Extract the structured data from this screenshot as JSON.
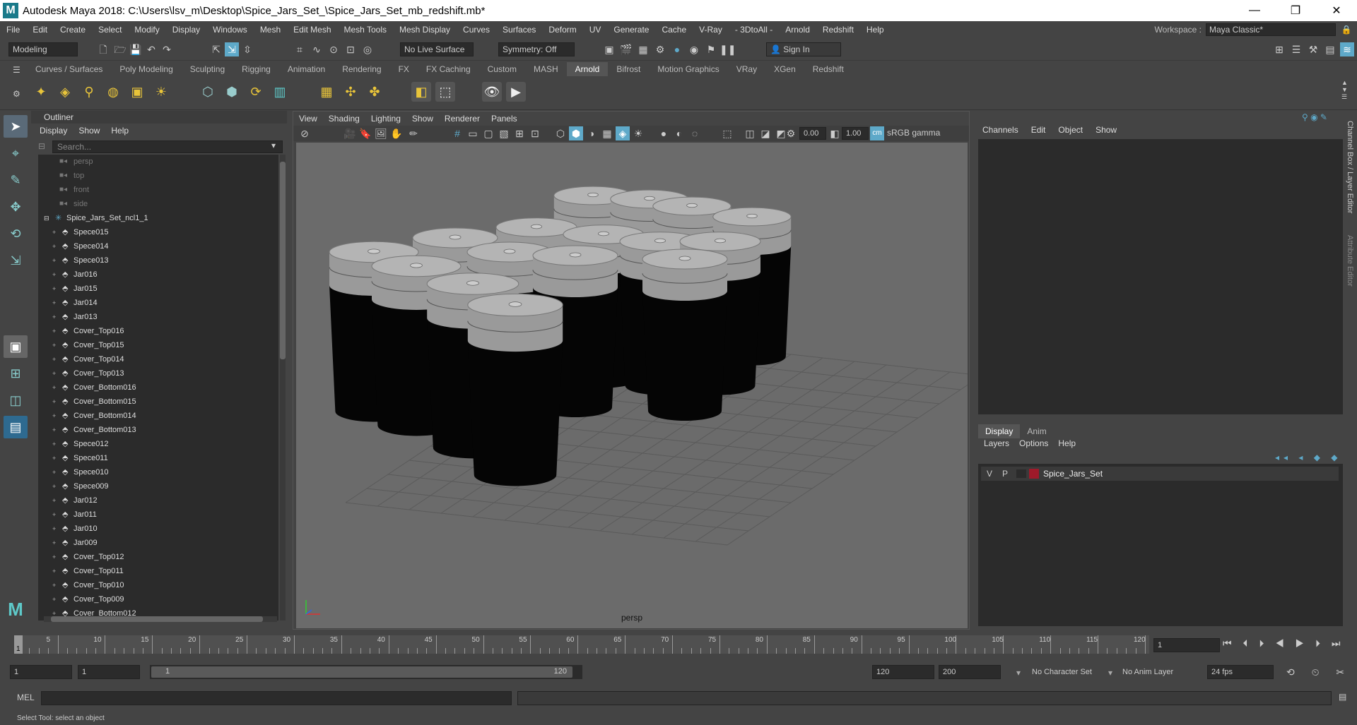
{
  "window": {
    "title": "Autodesk Maya 2018: C:\\Users\\lsv_m\\Desktop\\Spice_Jars_Set_\\Spice_Jars_Set_mb_redshift.mb*",
    "logo": "M"
  },
  "menu": [
    "File",
    "Edit",
    "Create",
    "Select",
    "Modify",
    "Display",
    "Windows",
    "Mesh",
    "Edit Mesh",
    "Mesh Tools",
    "Mesh Display",
    "Curves",
    "Surfaces",
    "Deform",
    "UV",
    "Generate",
    "Cache",
    "V-Ray",
    "- 3DtoAll -",
    "Arnold",
    "Redshift",
    "Help"
  ],
  "workspace": {
    "label": "Workspace :",
    "value": "Maya Classic*"
  },
  "status": {
    "mode": "Modeling",
    "live_surface": "No Live Surface",
    "symmetry": "Symmetry: Off",
    "sign_in": "Sign In"
  },
  "shelf_tabs": [
    "Curves / Surfaces",
    "Poly Modeling",
    "Sculpting",
    "Rigging",
    "Animation",
    "Rendering",
    "FX",
    "FX Caching",
    "Custom",
    "MASH",
    "Arnold",
    "Bifrost",
    "Motion Graphics",
    "VRay",
    "XGen",
    "Redshift"
  ],
  "shelf_active": "Arnold",
  "outliner": {
    "title": "Outliner",
    "menu": [
      "Display",
      "Show",
      "Help"
    ],
    "search_placeholder": "Search...",
    "cameras": [
      "persp",
      "top",
      "front",
      "side"
    ],
    "group": "Spice_Jars_Set_ncl1_1",
    "items": [
      "Spece015",
      "Spece014",
      "Spece013",
      "Jar016",
      "Jar015",
      "Jar014",
      "Jar013",
      "Cover_Top016",
      "Cover_Top015",
      "Cover_Top014",
      "Cover_Top013",
      "Cover_Bottom016",
      "Cover_Bottom015",
      "Cover_Bottom014",
      "Cover_Bottom013",
      "Spece012",
      "Spece011",
      "Spece010",
      "Spece009",
      "Jar012",
      "Jar011",
      "Jar010",
      "Jar009",
      "Cover_Top012",
      "Cover_Top011",
      "Cover_Top010",
      "Cover_Top009",
      "Cover_Bottom012"
    ]
  },
  "viewport": {
    "menu": [
      "View",
      "Shading",
      "Lighting",
      "Show",
      "Renderer",
      "Panels"
    ],
    "exposure": "0.00",
    "gamma": "1.00",
    "color_space": "sRGB gamma",
    "camera_label": "persp"
  },
  "channel_box": {
    "menu": [
      "Channels",
      "Edit",
      "Object",
      "Show"
    ],
    "side_tab_1": "Channel Box / Layer Editor",
    "side_tab_2": "Attribute Editor"
  },
  "layer_editor": {
    "tabs": [
      "Display",
      "Anim"
    ],
    "menu": [
      "Layers",
      "Options",
      "Help"
    ],
    "layer": {
      "v": "V",
      "p": "P",
      "name": "Spice_Jars_Set",
      "color": "#9e1a2a"
    }
  },
  "timeline": {
    "labels": [
      "5",
      "10",
      "15",
      "20",
      "25",
      "30",
      "35",
      "40",
      "45",
      "50",
      "55",
      "60",
      "65",
      "70",
      "75",
      "80",
      "85",
      "90",
      "95",
      "100",
      "105",
      "110",
      "115",
      "120"
    ],
    "start_marker": "1",
    "current_frame": "1"
  },
  "range": {
    "start": "1",
    "playback_start": "1",
    "slider_start": "1",
    "slider_end": "120",
    "playback_end": "120",
    "end": "200",
    "char_set": "No Character Set",
    "anim_layer": "No Anim Layer",
    "fps": "24 fps"
  },
  "command": {
    "lang": "MEL"
  },
  "help_line": "Select Tool: select an object",
  "colors": {
    "accent": "#5ea9c9",
    "panel": "#444444",
    "field": "#2b2b2b"
  }
}
